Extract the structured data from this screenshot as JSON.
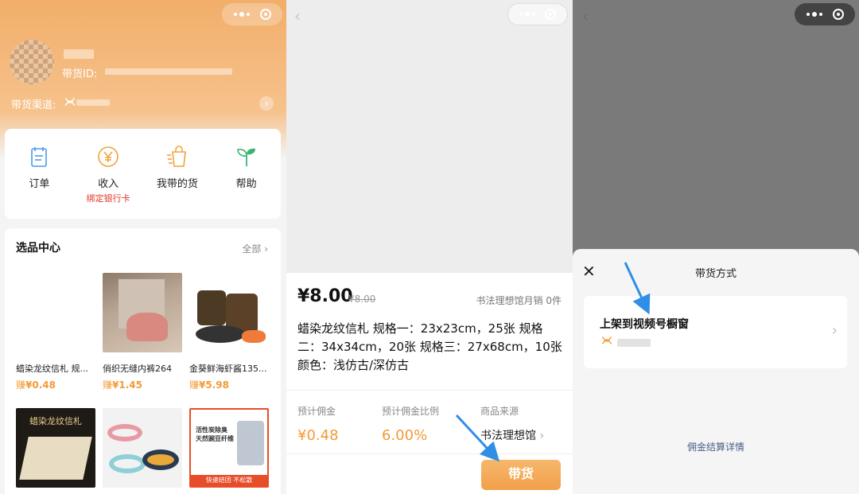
{
  "panel1": {
    "id_label": "带货ID:",
    "channel_label": "带货渠道:",
    "channel_icon": "channels-icon",
    "menu": [
      {
        "label": "订单",
        "sub": "",
        "icon": "order-list-icon"
      },
      {
        "label": "收入",
        "sub": "绑定银行卡",
        "icon": "yen-coin-icon"
      },
      {
        "label": "我带的货",
        "sub": "",
        "icon": "shopping-bag-icon"
      },
      {
        "label": "帮助",
        "sub": "",
        "icon": "sprout-icon"
      }
    ],
    "selection": {
      "title": "选品中心",
      "all_label": "全部",
      "products": [
        {
          "name": "蜡染龙纹信札 规...",
          "earn_prefix": "赚",
          "earn": "¥0.48"
        },
        {
          "name": "俏织无缝内裤264",
          "earn_prefix": "赚",
          "earn": "¥1.45"
        },
        {
          "name": "金葵鲜海虾酱135...",
          "earn_prefix": "赚",
          "earn": "¥5.98"
        }
      ],
      "bottom_products": [
        {
          "image_text": "蜡染龙纹信札"
        },
        {
          "image_text": ""
        },
        {
          "image_text_1": "活性炭除臭",
          "image_text_2": "天然豌豆纤维",
          "image_text_3": "快速结团 不松散"
        }
      ]
    }
  },
  "panel2": {
    "price": "¥8.00",
    "original_price": "¥8.00",
    "sales": "书法理想馆月销 0件",
    "title": "蜡染龙纹信札 规格一：23x23cm，25张 规格二：34x34cm，20张 规格三：27x68cm，10张 颜色：浅仿古/深仿古",
    "stats": {
      "commission_label": "预计佣金",
      "commission_value": "¥0.48",
      "ratio_label": "预计佣金比例",
      "ratio_value": "6.00%",
      "source_label": "商品来源",
      "source_value": "书法理想馆"
    },
    "button_label": "带货"
  },
  "panel3": {
    "sheet_title": "带货方式",
    "option_title": "上架到视频号橱窗",
    "settle_link": "佣金结算详情"
  },
  "colors": {
    "orange": "#f2ae6a",
    "accent": "#f39a35",
    "link": "#4a5f87",
    "red": "#e0392b"
  }
}
